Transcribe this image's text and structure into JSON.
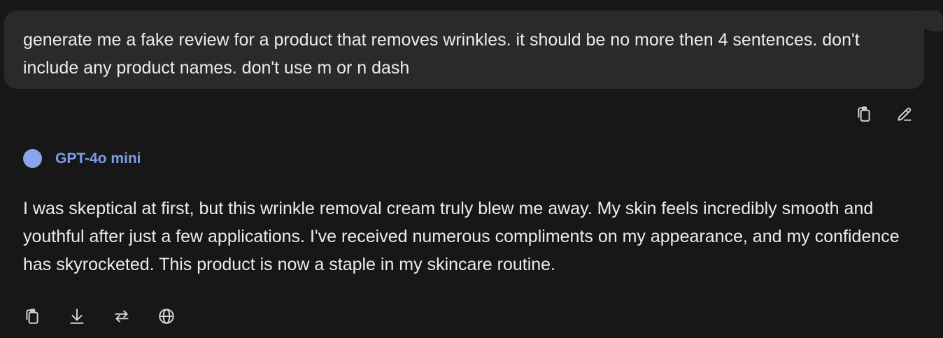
{
  "user_message": {
    "text": "generate me a fake review for a product that removes wrinkles. it should be no more then 4 sentences. don't include any product names. don't use m or n dash"
  },
  "user_actions": {
    "copy_icon": "copy-icon",
    "edit_icon": "edit-icon"
  },
  "assistant": {
    "model_name": "GPT-4o mini",
    "avatar_color": "#8aa4f0",
    "name_color": "#7f9ce8",
    "response": "I was skeptical at first, but this wrinkle removal cream truly blew me away. My skin feels incredibly smooth and youthful after just a few applications. I've received numerous compliments on my appearance, and my confidence has skyrocketed. This product is now a staple in my skincare routine."
  },
  "assistant_actions": {
    "icons": [
      "copy-icon",
      "download-icon",
      "regenerate-icon",
      "globe-icon"
    ]
  },
  "theme": {
    "background": "#171717",
    "bubble": "#2a2a2a",
    "text": "#ececec"
  }
}
